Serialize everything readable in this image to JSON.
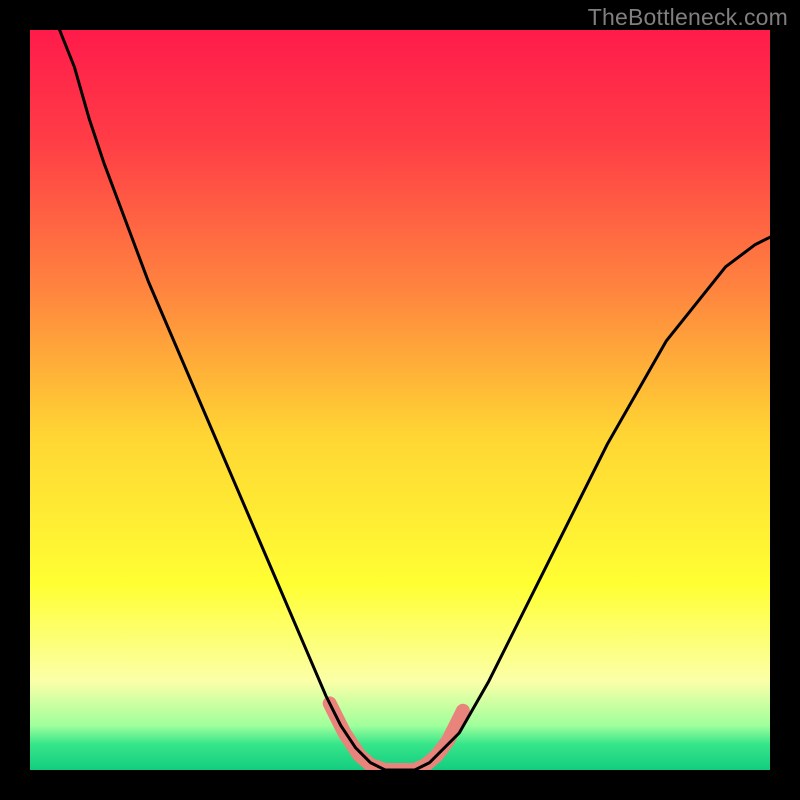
{
  "watermark": "TheBottleneck.com",
  "chart_data": {
    "type": "line",
    "title": "",
    "xlabel": "",
    "ylabel": "",
    "xlim": [
      0,
      100
    ],
    "ylim": [
      0,
      100
    ],
    "gradient_stops": [
      {
        "offset": 0.0,
        "color": "#ff1b4b"
      },
      {
        "offset": 0.15,
        "color": "#ff3d46"
      },
      {
        "offset": 0.35,
        "color": "#ff843f"
      },
      {
        "offset": 0.55,
        "color": "#ffd633"
      },
      {
        "offset": 0.75,
        "color": "#ffff33"
      },
      {
        "offset": 0.88,
        "color": "#fbffa8"
      },
      {
        "offset": 0.94,
        "color": "#9fff9c"
      },
      {
        "offset": 0.965,
        "color": "#37e58a"
      },
      {
        "offset": 1.0,
        "color": "#12cd7f"
      }
    ],
    "series": [
      {
        "name": "primary-curve",
        "color": "#000000",
        "stroke_width": 3,
        "x": [
          4,
          6,
          8,
          10,
          13,
          16,
          19,
          22,
          25,
          28,
          31,
          34,
          37,
          40,
          42,
          44,
          46,
          48,
          50,
          52,
          54,
          58,
          62,
          66,
          70,
          74,
          78,
          82,
          86,
          90,
          94,
          98,
          100
        ],
        "y": [
          100,
          95,
          88,
          82,
          74,
          66,
          59,
          52,
          45,
          38,
          31,
          24,
          17,
          10,
          6,
          3,
          1,
          0,
          0,
          0,
          1,
          5,
          12,
          20,
          28,
          36,
          44,
          51,
          58,
          63,
          68,
          71,
          72
        ]
      },
      {
        "name": "valley-highlight",
        "color": "#e9847c",
        "stroke_width": 14,
        "x": [
          40.5,
          41.5,
          42.5,
          43.5,
          44.5,
          46,
          48,
          50,
          52,
          53.5,
          55,
          56.5,
          57.5,
          58.5
        ],
        "y": [
          9,
          7,
          5,
          3.5,
          2,
          0.7,
          0,
          0,
          0,
          0.7,
          2,
          4,
          6,
          8
        ]
      }
    ],
    "annotations": []
  }
}
